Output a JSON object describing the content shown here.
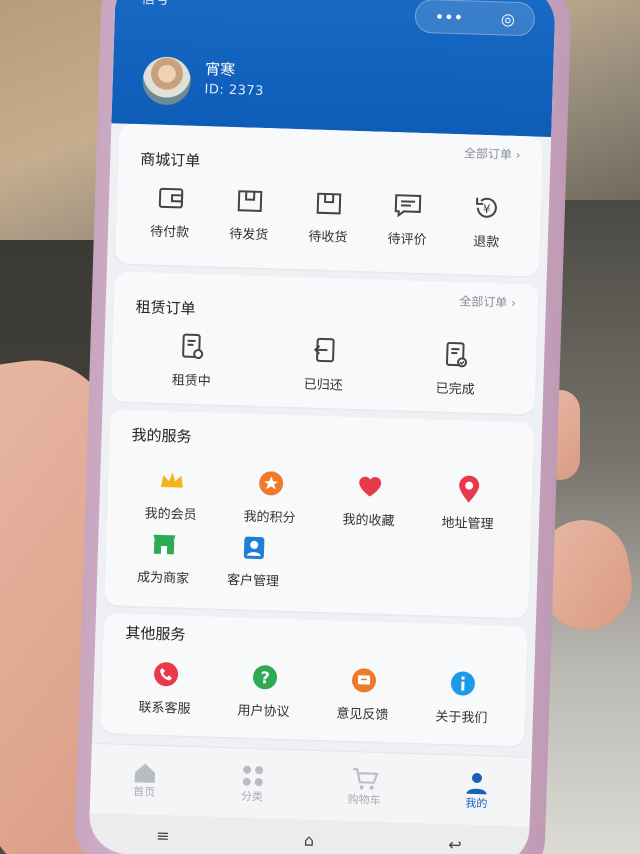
{
  "header": {
    "status": "信号",
    "capsule_menu": "•••",
    "capsule_close": "◎",
    "username": "宵寒",
    "user_id": "ID: 2373"
  },
  "mall_orders": {
    "title": "商城订单",
    "all_link": "全部订单 ›",
    "items": [
      "待付款",
      "待发货",
      "待收货",
      "待评价",
      "退款"
    ]
  },
  "rental_orders": {
    "title": "租赁订单",
    "all_link": "全部订单 ›",
    "items": [
      "租赁中",
      "已归还",
      "已完成"
    ]
  },
  "my_services": {
    "title": "我的服务",
    "items": [
      "我的会员",
      "我的积分",
      "我的收藏",
      "地址管理",
      "成为商家",
      "客户管理"
    ]
  },
  "other_services": {
    "title": "其他服务",
    "items": [
      "联系客服",
      "用户协议",
      "意见反馈",
      "关于我们"
    ]
  },
  "tabbar": {
    "items": [
      "首页",
      "分类",
      "购物车",
      "我的"
    ]
  },
  "colors": {
    "header_blue": "#0d5db8",
    "accent_active": "#1a5fb8",
    "orange": "#f07a2c",
    "red": "#e83a4b",
    "green": "#2eaa52",
    "gold": "#f2b51b",
    "blue_info": "#1e9be8"
  },
  "icons": {
    "mall": [
      "wallet-icon",
      "box-icon",
      "package-icon",
      "comment-icon",
      "refund-icon"
    ],
    "rental": [
      "document-icon",
      "return-icon",
      "document-check-icon"
    ],
    "services": [
      "crown-icon",
      "star-badge-icon",
      "heart-icon",
      "location-pin-icon",
      "shop-icon",
      "contact-card-icon"
    ],
    "other": [
      "phone-icon",
      "help-icon",
      "feedback-icon",
      "info-icon"
    ],
    "tabs": [
      "home-icon",
      "grid-icon",
      "cart-icon",
      "user-icon"
    ]
  }
}
